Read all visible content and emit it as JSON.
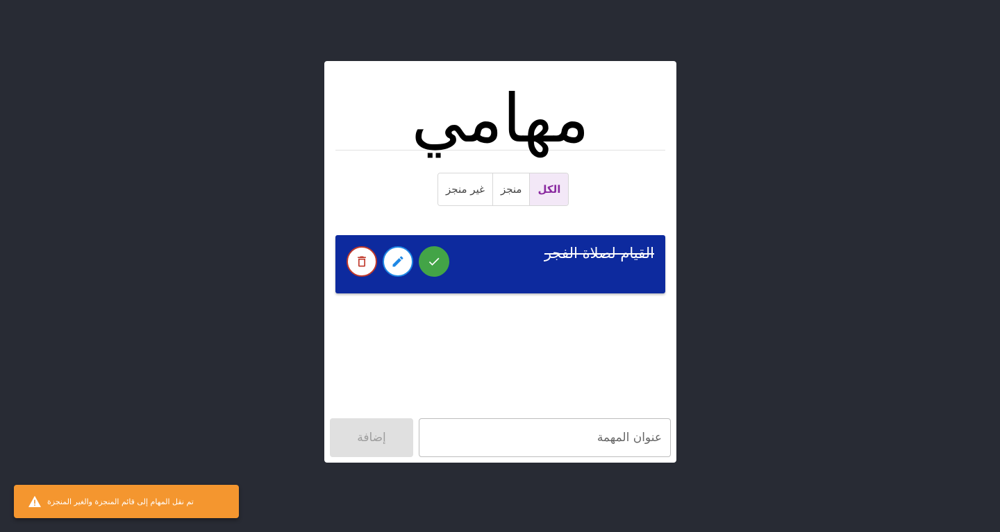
{
  "header": {
    "title": "مهامي"
  },
  "filters": [
    {
      "label": "الكل",
      "active": true
    },
    {
      "label": "منجز",
      "active": false
    },
    {
      "label": "غير منجز",
      "active": false
    }
  ],
  "tasks": [
    {
      "title": "القيام لصلاة الفجر",
      "completed": true,
      "actions": {
        "done_icon": "check-icon",
        "edit_icon": "pencil-icon",
        "delete_icon": "trash-icon"
      }
    }
  ],
  "form": {
    "input_value": "",
    "input_placeholder": "عنوان المهمة",
    "add_label": "إضافة",
    "add_disabled": true
  },
  "toast": {
    "icon": "warning-icon",
    "message": "تم نقل المهام إلى قائم المنجزة والغير المنجزة"
  },
  "colors": {
    "background": "#282b34",
    "task_background": "#0d2a9e",
    "toast_background": "#f4962f",
    "filter_active": "#8a2aa0",
    "done_green": "#43a447",
    "edit_blue": "#1e88e5",
    "delete_red": "#c0392b"
  }
}
